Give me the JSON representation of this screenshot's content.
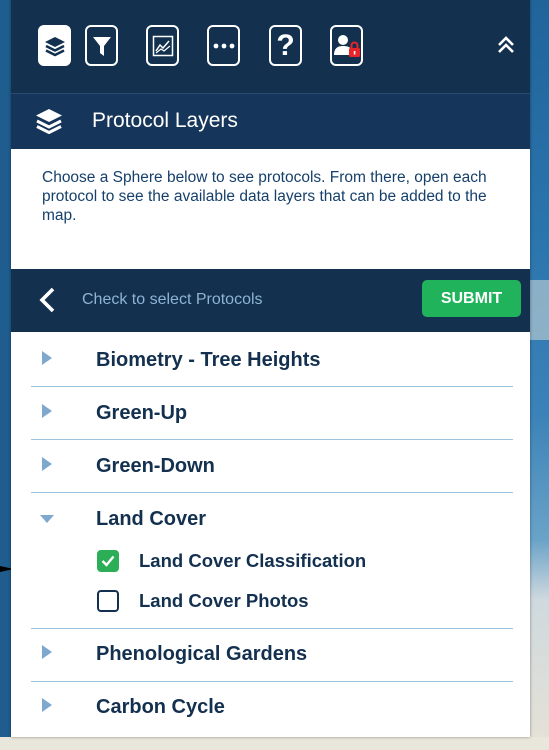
{
  "toolbar": {
    "buttons": [
      {
        "name": "layers",
        "icon": "layers-icon",
        "active": true
      },
      {
        "name": "filter",
        "icon": "filter-icon"
      },
      {
        "name": "chart",
        "icon": "line-chart-icon"
      },
      {
        "name": "more",
        "icon": "ellipsis-icon"
      },
      {
        "name": "help",
        "icon": "question-icon",
        "glyph": "?"
      },
      {
        "name": "user-lock",
        "icon": "user-lock-icon"
      }
    ],
    "collapse_icon": "double-chevron-up-icon"
  },
  "header": {
    "title": "Protocol Layers",
    "icon": "layers-icon"
  },
  "description": "Choose a Sphere below to see protocols. From there, open each protocol to see the available data layers that can be added to the map.",
  "select_bar": {
    "hint": "Check to select Protocols",
    "submit_label": "SUBMIT",
    "back_icon": "chevron-left-icon"
  },
  "protocols": [
    {
      "label": "Biometry - Tree Heights",
      "expanded": false
    },
    {
      "label": "Green-Up",
      "expanded": false
    },
    {
      "label": "Green-Down",
      "expanded": false
    },
    {
      "label": "Land Cover",
      "expanded": true,
      "layers": [
        {
          "label": "Land Cover Classification",
          "checked": true
        },
        {
          "label": "Land Cover Photos",
          "checked": false
        }
      ]
    },
    {
      "label": "Phenological Gardens",
      "expanded": false
    },
    {
      "label": "Carbon Cycle",
      "expanded": false
    }
  ],
  "colors": {
    "navy": "#13304f",
    "submit_green": "#21b35c",
    "checkbox_green": "#2bae56",
    "caret_blue": "#7fa8cf",
    "divider": "#9cc3dc"
  }
}
